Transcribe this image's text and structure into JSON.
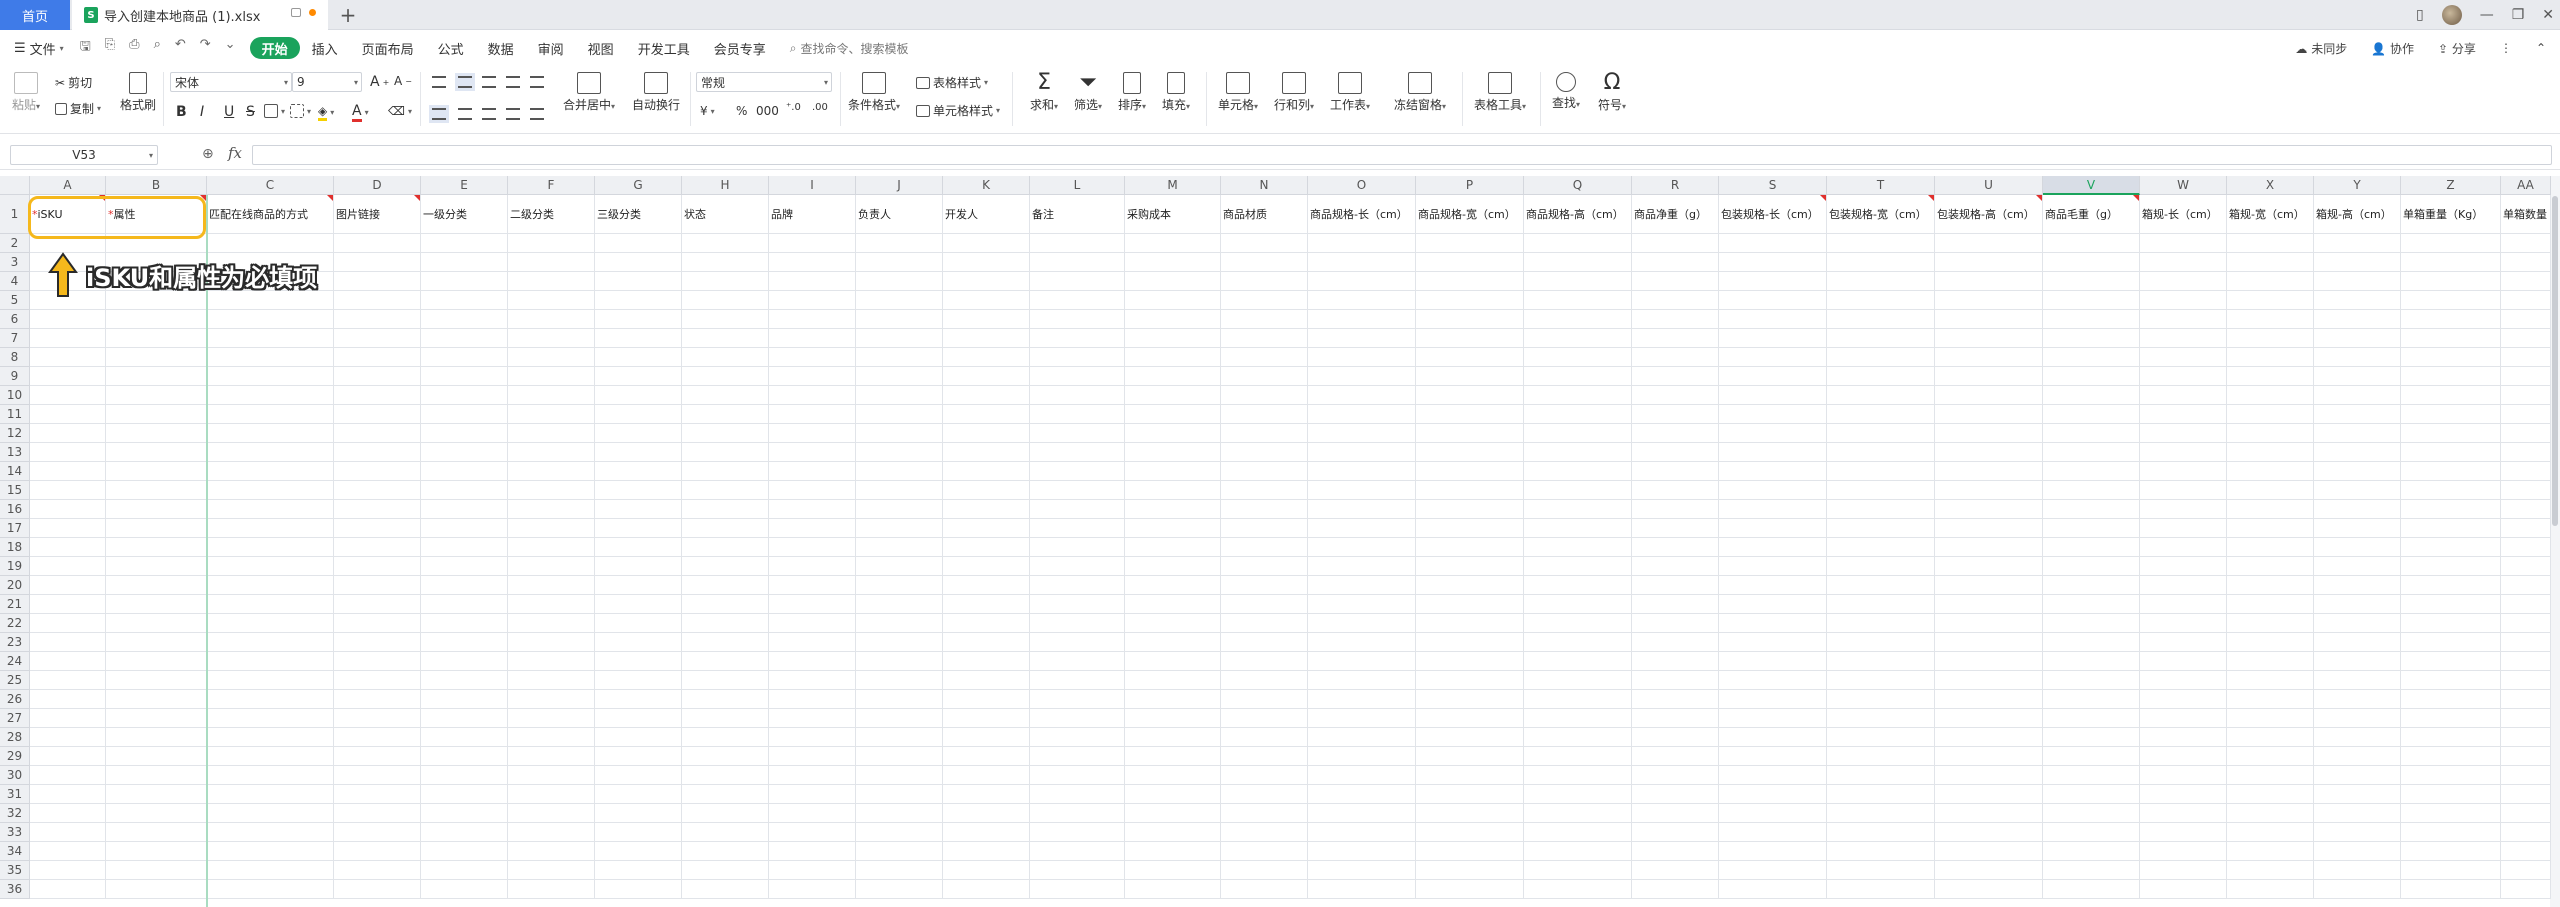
{
  "tabs": {
    "home": "首页",
    "document": "导入创建本地商品 (1).xlsx",
    "add": "+"
  },
  "menu": {
    "file": "文件",
    "items": [
      "开始",
      "插入",
      "页面布局",
      "公式",
      "数据",
      "审阅",
      "视图",
      "开发工具",
      "会员专享"
    ],
    "active_index": 0,
    "search": "查找命令、搜索模板",
    "right": {
      "sync": "未同步",
      "collab": "协作",
      "share": "分享"
    }
  },
  "ribbon": {
    "paste": "粘贴",
    "cut": "剪切",
    "copy": "复制",
    "format_painter": "格式刷",
    "font_name": "宋体",
    "font_size": "9",
    "merge_center": "合并居中",
    "wrap_text": "自动换行",
    "number_format": "常规",
    "conditional_format": "条件格式",
    "table_style": "表格样式",
    "cell_style": "单元格样式",
    "sum": "求和",
    "filter": "筛选",
    "sort": "排序",
    "fill": "填充",
    "cell": "单元格",
    "row_col": "行和列",
    "worksheet": "工作表",
    "freeze": "冻结窗格",
    "table_tools": "表格工具",
    "find": "查找",
    "symbol": "符号"
  },
  "formula_bar": {
    "cell_ref": "V53",
    "fx": "fx",
    "value": ""
  },
  "sheet": {
    "columns": [
      "A",
      "B",
      "C",
      "D",
      "E",
      "F",
      "G",
      "H",
      "I",
      "J",
      "K",
      "L",
      "M",
      "N",
      "O",
      "P",
      "Q",
      "R",
      "S",
      "T",
      "U",
      "V",
      "W",
      "X",
      "Y",
      "Z",
      "AA"
    ],
    "selected_column": "V",
    "headers": [
      {
        "req": "*",
        "text": "iSKU"
      },
      {
        "req": "*",
        "text": "属性"
      },
      {
        "req": "",
        "text": "匹配在线商品的方式"
      },
      {
        "req": "",
        "text": "图片链接"
      },
      {
        "req": "",
        "text": "一级分类"
      },
      {
        "req": "",
        "text": "二级分类"
      },
      {
        "req": "",
        "text": "三级分类"
      },
      {
        "req": "",
        "text": "状态"
      },
      {
        "req": "",
        "text": "品牌"
      },
      {
        "req": "",
        "text": "负责人"
      },
      {
        "req": "",
        "text": "开发人"
      },
      {
        "req": "",
        "text": "备注"
      },
      {
        "req": "",
        "text": "采购成本"
      },
      {
        "req": "",
        "text": "商品材质"
      },
      {
        "req": "",
        "text": "商品规格-长（cm）"
      },
      {
        "req": "",
        "text": "商品规格-宽（cm）"
      },
      {
        "req": "",
        "text": "商品规格-高（cm）"
      },
      {
        "req": "",
        "text": "商品净重（g）"
      },
      {
        "req": "",
        "text": "包装规格-长（cm）"
      },
      {
        "req": "",
        "text": "包装规格-宽（cm）"
      },
      {
        "req": "",
        "text": "包装规格-高（cm）"
      },
      {
        "req": "",
        "text": "商品毛重（g）"
      },
      {
        "req": "",
        "text": "箱规-长（cm）"
      },
      {
        "req": "",
        "text": "箱规-宽（cm）"
      },
      {
        "req": "",
        "text": "箱规-高（cm）"
      },
      {
        "req": "",
        "text": "单箱重量（Kg）"
      },
      {
        "req": "",
        "text": "单箱数量"
      }
    ],
    "row_numbers": [
      "1",
      "2",
      "3",
      "4",
      "5",
      "6",
      "7",
      "8",
      "9",
      "10",
      "11",
      "12",
      "13",
      "14",
      "15",
      "16",
      "17",
      "18",
      "19",
      "20",
      "21",
      "22",
      "23",
      "24",
      "25",
      "26",
      "27",
      "28",
      "29",
      "30",
      "31",
      "32",
      "33",
      "34",
      "35",
      "36"
    ]
  },
  "annotation": {
    "text": "iSKU和属性为必填项",
    "color": "#f5b81c"
  },
  "colors": {
    "accent_green": "#1aa35c",
    "home_tab_blue": "#3f7be8",
    "required_red": "#e0302d"
  }
}
